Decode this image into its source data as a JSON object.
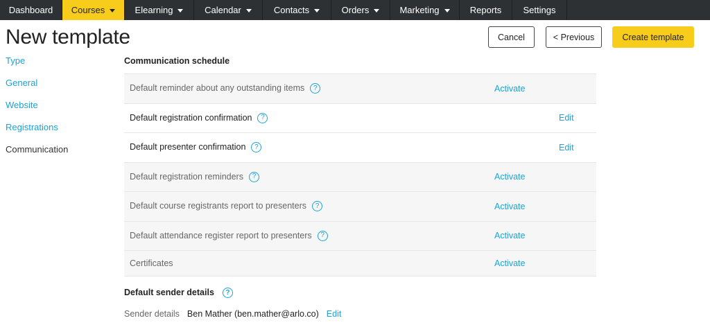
{
  "nav": {
    "items": [
      {
        "label": "Dashboard",
        "dropdown": false,
        "active": false
      },
      {
        "label": "Courses",
        "dropdown": true,
        "active": true
      },
      {
        "label": "Elearning",
        "dropdown": true,
        "active": false
      },
      {
        "label": "Calendar",
        "dropdown": true,
        "active": false
      },
      {
        "label": "Contacts",
        "dropdown": true,
        "active": false
      },
      {
        "label": "Orders",
        "dropdown": true,
        "active": false
      },
      {
        "label": "Marketing",
        "dropdown": true,
        "active": false
      },
      {
        "label": "Reports",
        "dropdown": false,
        "active": false
      },
      {
        "label": "Settings",
        "dropdown": false,
        "active": false
      }
    ]
  },
  "header": {
    "title": "New template",
    "cancel_label": "Cancel",
    "previous_label": "< Previous",
    "create_label": "Create template"
  },
  "sidebar": {
    "items": [
      {
        "label": "Type"
      },
      {
        "label": "General"
      },
      {
        "label": "Website"
      },
      {
        "label": "Registrations"
      },
      {
        "label": "Communication"
      }
    ],
    "current": "Communication"
  },
  "schedule": {
    "title": "Communication schedule",
    "rows": [
      {
        "label": "Default reminder about any outstanding items",
        "help": true,
        "action": "Activate",
        "state": "inactive"
      },
      {
        "label": "Default registration confirmation",
        "help": true,
        "action": "Edit",
        "state": "active"
      },
      {
        "label": "Default presenter confirmation",
        "help": true,
        "action": "Edit",
        "state": "active"
      },
      {
        "label": "Default registration reminders",
        "help": true,
        "action": "Activate",
        "state": "inactive"
      },
      {
        "label": "Default course registrants report to presenters",
        "help": true,
        "action": "Activate",
        "state": "inactive"
      },
      {
        "label": "Default attendance register report to presenters",
        "help": true,
        "action": "Activate",
        "state": "inactive"
      },
      {
        "label": "Certificates",
        "help": false,
        "action": "Activate",
        "state": "inactive"
      }
    ]
  },
  "sender": {
    "title": "Default sender details",
    "label": "Sender details",
    "value": "Ben Mather (ben.mather@arlo.co)",
    "edit_label": "Edit"
  },
  "icons": {
    "help": "question-circle-icon",
    "dropdown": "caret-down-icon"
  },
  "colors": {
    "nav_bg": "#2d3134",
    "accent_yellow": "#f8cc1b",
    "link_blue": "#1ba3d6",
    "inactive_row_bg": "#f6f6f6"
  }
}
